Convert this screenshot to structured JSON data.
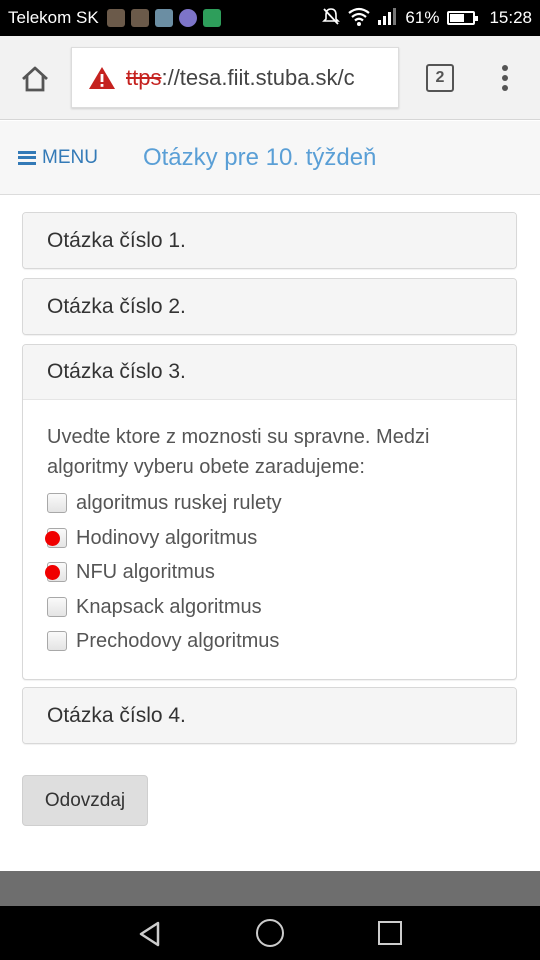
{
  "status_bar": {
    "carrier": "Telekom SK",
    "notification_icons": [
      "person-avatar-icon",
      "photo-avatar-icon",
      "gallery-icon",
      "messenger-m-icon",
      "download-icon"
    ],
    "battery_percent": "61%",
    "battery_level": 0.61,
    "time": "15:28"
  },
  "browser": {
    "url_scheme": "ttps",
    "url_rest": "://tesa.fiit.stuba.sk/c",
    "tab_count": "2"
  },
  "header": {
    "menu_label": "MENU",
    "page_title": "Otázky pre 10. týždeň"
  },
  "questions": [
    {
      "title": "Otázka číslo 1."
    },
    {
      "title": "Otázka číslo 2."
    },
    {
      "title": "Otázka číslo 3.",
      "text": "Uvedte ktore z moznosti su spravne. Medzi algoritmy vyberu obete zaradujeme:",
      "options": [
        {
          "label": "algoritmus ruskej rulety",
          "marked": false
        },
        {
          "label": "Hodinovy algoritmus",
          "marked": true
        },
        {
          "label": "NFU algoritmus",
          "marked": true
        },
        {
          "label": "Knapsack algoritmus",
          "marked": false
        },
        {
          "label": "Prechodovy algoritmus",
          "marked": false
        }
      ]
    },
    {
      "title": "Otázka číslo 4."
    }
  ],
  "submit_label": "Odovzdaj",
  "colors": {
    "link_blue": "#337ab7",
    "title_blue": "#5a9fd6",
    "warning_red": "#c5221f",
    "mark_red": "#f00000"
  }
}
